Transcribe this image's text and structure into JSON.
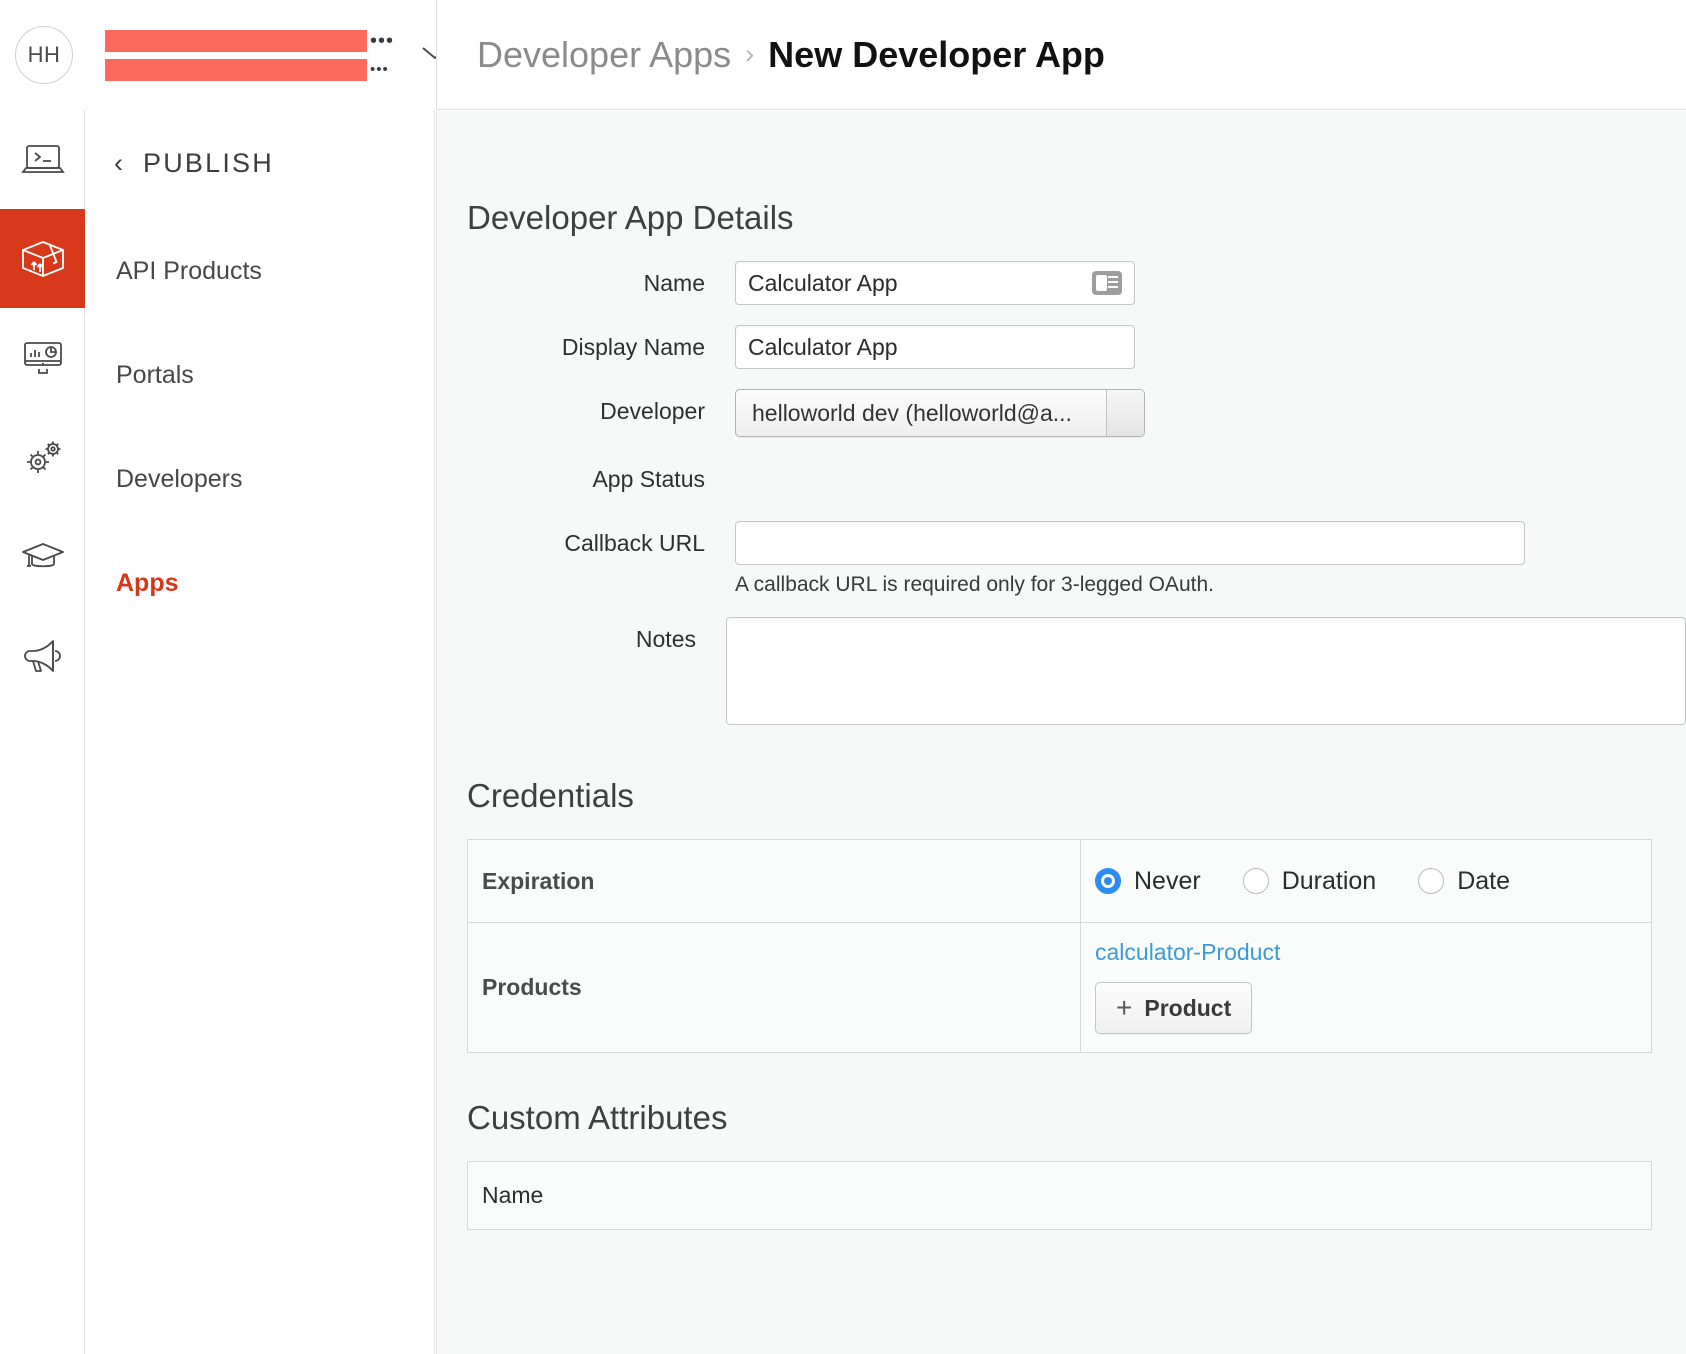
{
  "account": {
    "avatar_initials": "HH",
    "org_redacted_1": "",
    "org_redacted_2": "",
    "dots_1": "•••",
    "dots_2": "•••",
    "chevron": "⌄"
  },
  "rail": {
    "items": [
      {
        "name": "develop-icon",
        "label": "Develop"
      },
      {
        "name": "publish-icon",
        "label": "Publish",
        "active": true
      },
      {
        "name": "analyze-icon",
        "label": "Analyze"
      },
      {
        "name": "admin-icon",
        "label": "Admin"
      },
      {
        "name": "learn-icon",
        "label": "Learn"
      },
      {
        "name": "announcements-icon",
        "label": "Announcements"
      }
    ]
  },
  "subnav": {
    "back_chevron": "‹",
    "title": "PUBLISH",
    "items": [
      {
        "label": "API Products",
        "active": false
      },
      {
        "label": "Portals",
        "active": false
      },
      {
        "label": "Developers",
        "active": false
      },
      {
        "label": "Apps",
        "active": true
      }
    ]
  },
  "header": {
    "breadcrumb_parent": "Developer Apps",
    "breadcrumb_sep": "›",
    "breadcrumb_current": "New Developer App"
  },
  "details": {
    "section_title": "Developer App Details",
    "name_label": "Name",
    "name_value": "Calculator App",
    "display_name_label": "Display Name",
    "display_name_value": "Calculator App",
    "developer_label": "Developer",
    "developer_value": "helloworld dev (helloworld@a...",
    "app_status_label": "App Status",
    "app_status_value": "",
    "callback_label": "Callback URL",
    "callback_value": "",
    "callback_placeholder": "",
    "callback_hint": "A callback URL is required only for 3-legged OAuth.",
    "notes_label": "Notes",
    "notes_value": "",
    "notes_placeholder": ""
  },
  "credentials": {
    "section_title": "Credentials",
    "expiration_label": "Expiration",
    "expiration_options": [
      {
        "label": "Never",
        "selected": true
      },
      {
        "label": "Duration",
        "selected": false
      },
      {
        "label": "Date",
        "selected": false
      }
    ],
    "products_label": "Products",
    "product_link": "calculator-Product",
    "add_product_plus": "+",
    "add_product_label": "Product"
  },
  "custom_attributes": {
    "section_title": "Custom Attributes",
    "column_name": "Name"
  },
  "colors": {
    "accent_red": "#d9391b",
    "active_link_red": "#d5371b",
    "radio_blue": "#2c8af3",
    "product_link_blue": "#3c9ad9",
    "redaction": "#fb6a5c",
    "main_bg": "#f7f8f8"
  }
}
